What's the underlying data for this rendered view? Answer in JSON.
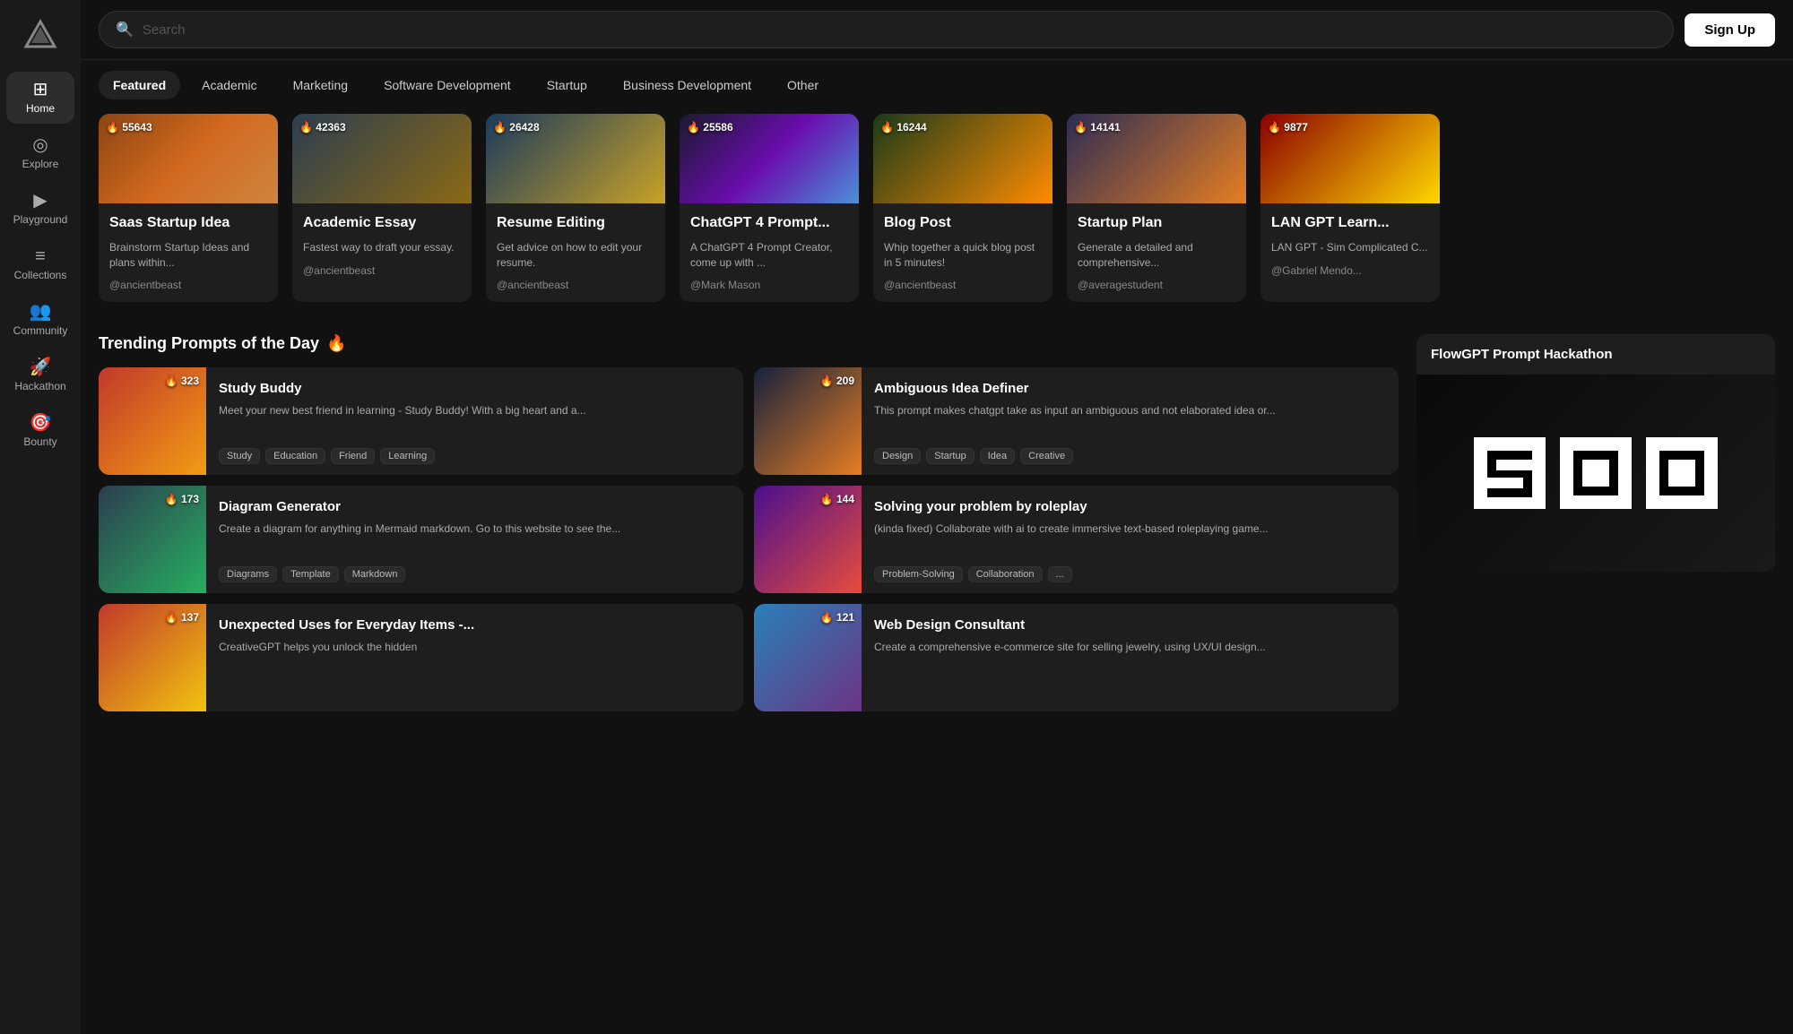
{
  "sidebar": {
    "logo_title": "FlowGPT",
    "items": [
      {
        "id": "home",
        "label": "Home",
        "icon": "⊞",
        "active": true
      },
      {
        "id": "explore",
        "label": "Explore",
        "icon": "◎"
      },
      {
        "id": "playground",
        "label": "Playground",
        "icon": "▶"
      },
      {
        "id": "collections",
        "label": "Collections",
        "icon": "≡"
      },
      {
        "id": "community",
        "label": "Community",
        "icon": "👥"
      },
      {
        "id": "hackathon",
        "label": "Hackathon",
        "icon": "🚀"
      },
      {
        "id": "bounty",
        "label": "Bounty",
        "icon": "🎯"
      }
    ]
  },
  "header": {
    "search_placeholder": "Search",
    "signup_label": "Sign Up"
  },
  "tabs": {
    "items": [
      {
        "id": "featured",
        "label": "Featured",
        "active": true
      },
      {
        "id": "academic",
        "label": "Academic"
      },
      {
        "id": "marketing",
        "label": "Marketing"
      },
      {
        "id": "software-dev",
        "label": "Software Development"
      },
      {
        "id": "startup",
        "label": "Startup"
      },
      {
        "id": "business-dev",
        "label": "Business Development"
      },
      {
        "id": "other",
        "label": "Other"
      }
    ]
  },
  "featured_cards": [
    {
      "id": 1,
      "count": "55643",
      "title": "Saas Startup Idea",
      "desc": "Brainstorm Startup Ideas and plans within...",
      "author": "@ancientbeast",
      "grad": "grad-1"
    },
    {
      "id": 2,
      "count": "42363",
      "title": "Academic Essay",
      "desc": "Fastest way to draft your essay.",
      "author": "@ancientbeast",
      "grad": "grad-2"
    },
    {
      "id": 3,
      "count": "26428",
      "title": "Resume Editing",
      "desc": "Get advice on how to edit your resume.",
      "author": "@ancientbeast",
      "grad": "grad-3"
    },
    {
      "id": 4,
      "count": "25586",
      "title": "ChatGPT 4 Prompt...",
      "desc": "A ChatGPT 4 Prompt Creator, come up with ...",
      "author": "@Mark Mason",
      "grad": "grad-4"
    },
    {
      "id": 5,
      "count": "16244",
      "title": "Blog Post",
      "desc": "Whip together a quick blog post in 5 minutes!",
      "author": "@ancientbeast",
      "grad": "grad-5"
    },
    {
      "id": 6,
      "count": "14141",
      "title": "Startup Plan",
      "desc": "Generate a detailed and comprehensive...",
      "author": "@averagestudent",
      "grad": "grad-6"
    },
    {
      "id": 7,
      "count": "9877",
      "title": "LAN GPT Learn...",
      "desc": "LAN GPT - Sim Complicated C...",
      "author": "@Gabriel Mendo...",
      "grad": "grad-7"
    }
  ],
  "trending": {
    "title": "Trending Prompts of the Day",
    "emoji": "🔥",
    "cards": [
      {
        "id": 1,
        "count": "323",
        "title": "Study Buddy",
        "desc": "Meet your new best friend in learning - Study Buddy! With a big heart and a...",
        "tags": [
          "Study",
          "Education",
          "Friend",
          "Learning"
        ],
        "grad": "tgrad-1"
      },
      {
        "id": 2,
        "count": "209",
        "title": "Ambiguous Idea Definer",
        "desc": "This prompt makes chatgpt take as input an ambiguous and not elaborated idea or...",
        "tags": [
          "Design",
          "Startup",
          "Idea",
          "Creative"
        ],
        "grad": "tgrad-2"
      },
      {
        "id": 3,
        "count": "173",
        "title": "Diagram Generator",
        "desc": "Create a diagram for anything in Mermaid markdown. Go to this website to see the...",
        "tags": [
          "Diagrams",
          "Template",
          "Markdown"
        ],
        "grad": "tgrad-3"
      },
      {
        "id": 4,
        "count": "144",
        "title": "Solving your problem by roleplay",
        "desc": "(kinda fixed) Collaborate with ai to create immersive text-based roleplaying game...",
        "tags": [
          "Problem-Solving",
          "Collaboration",
          "..."
        ],
        "grad": "tgrad-4"
      },
      {
        "id": 5,
        "count": "137",
        "title": "Unexpected Uses for Everyday Items -...",
        "desc": "CreativeGPT helps you unlock the hidden",
        "tags": [],
        "grad": "tgrad-5"
      },
      {
        "id": 6,
        "count": "121",
        "title": "Web Design Consultant",
        "desc": "Create a comprehensive e-commerce site for selling jewelry, using UX/UI design...",
        "tags": [],
        "grad": "tgrad-6"
      }
    ]
  },
  "hackathon": {
    "title": "FlowGPT Prompt Hackathon",
    "logos": [
      "S",
      "0",
      "0"
    ]
  }
}
